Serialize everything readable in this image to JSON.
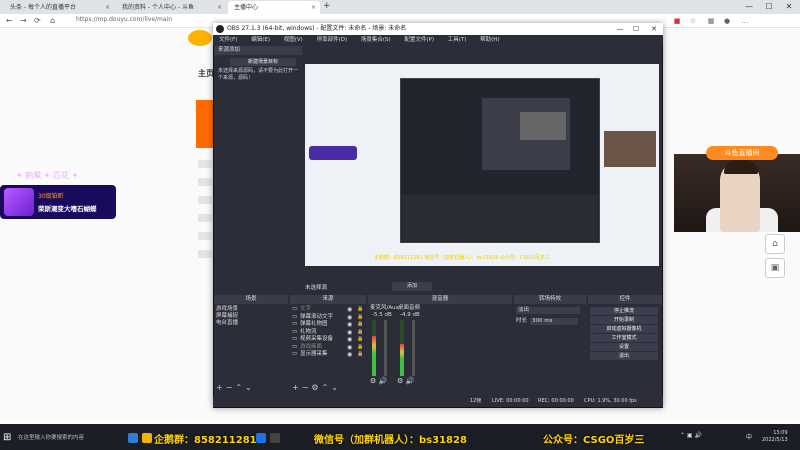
{
  "browser": {
    "tabs": [
      {
        "label": "头条 - 每个人的直播平台"
      },
      {
        "label": "我的资料 - 个人中心 - 斗鱼"
      },
      {
        "label": "主播中心"
      }
    ],
    "url": "https://mp.douyu.com/live/main"
  },
  "web": {
    "main_label": "主页"
  },
  "gift_widget": {
    "username": "30级铂昕",
    "text": "荣斯潮变大嗜石蝴蝶",
    "deco": "✦ 鹤鹭 ✦ 匹花 ✦"
  },
  "cam": {
    "sign": "斗鱼直播间"
  },
  "obs": {
    "title": "OBS 27.1.3 (64-bit, windows) - 配置文件: 未命名 - 场景: 未命名",
    "menu": [
      "文件(F)",
      "编辑(E)",
      "视图(V)",
      "停靠部件(D)",
      "场景集合(S)",
      "配置文件(P)",
      "工具(T)",
      "帮助(H)"
    ],
    "scene_tab": "来源添加",
    "missing_files_button": "新建场景目标",
    "missing_files_text": "未选择来源源码，请不要为此打开一个来源，源码！",
    "ticker": "企鹅群：858211281 微信号（加群机器人）：bs31828 公众号：CSGO百岁三",
    "no_stream_label": "未选择源",
    "preview_ctrl": "添加",
    "docks": {
      "scenes_title": "场景",
      "sources_title": "来源",
      "mixer_title": "混音器",
      "transitions_title": "转场特效",
      "controls_title": "控件"
    },
    "scenes": [
      "游戏场景",
      "屏幕捕捉",
      "电台直播"
    ],
    "sources": [
      {
        "name": "文字",
        "dim": true
      },
      {
        "name": "弹幕滚动文字",
        "dim": false
      },
      {
        "name": "弹幕礼物图",
        "dim": false
      },
      {
        "name": "礼物流",
        "dim": false
      },
      {
        "name": "视频采集设备",
        "dim": false
      },
      {
        "name": "游戏画面",
        "dim": true
      },
      {
        "name": "显示器采集",
        "dim": false
      }
    ],
    "mixer": {
      "ch1_label": "麦克风/Aux",
      "ch2_label": "桌面音频",
      "ch1_db": "-5.5 dB",
      "ch2_db": "-4.9 dB",
      "ch1_level": 0.72,
      "ch2_level": 0.58
    },
    "transitions": {
      "type": "淡出",
      "duration_label": "时长",
      "duration": "300 ms"
    },
    "controls": [
      "停止推流",
      "开始录制",
      "启动虚拟摄像机",
      "工作室模式",
      "设置",
      "退出"
    ],
    "status": {
      "live": "LIVE: 00:00:00",
      "rec": "REC: 00:00:00",
      "cpu": "CPU: 1.9%, 30.00 fps",
      "dropped": "12帧"
    }
  },
  "ads": {
    "qq": "企鹅群：858211281",
    "wechat": "微信号（加群机器人）：bs31828",
    "gzh": "公众号：CSGO百岁三"
  },
  "taskbar": {
    "search_placeholder": "在这里输入你要搜索的内容",
    "time": "13:09",
    "date": "2022/5/13",
    "lang": "中"
  }
}
